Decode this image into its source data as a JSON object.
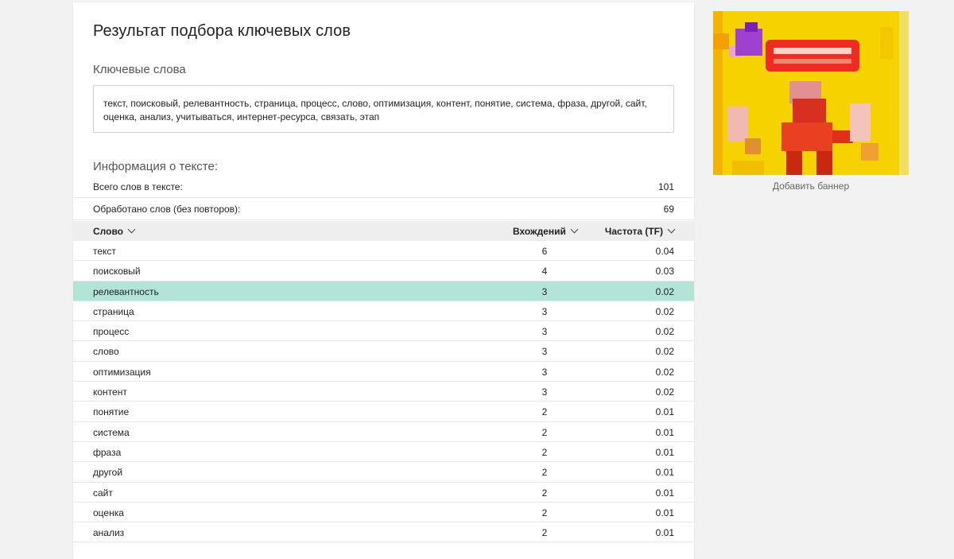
{
  "title": "Результат подбора ключевых слов",
  "keywords": {
    "heading": "Ключевые слова",
    "text": "текст, поисковый, релевантность, страница, процесс, слово, оптимизация, контент, понятие, система, фраза, другой, сайт, оценка, анализ, учитываться, интернет-ресурса, связать, этап"
  },
  "info": {
    "heading": "Информация о тексте:",
    "rows": [
      {
        "label": "Всего слов в тексте:",
        "value": "101"
      },
      {
        "label": "Обработано слов (без повторов):",
        "value": "69"
      }
    ]
  },
  "table": {
    "headers": {
      "word": "Слово",
      "count": "Вхождений",
      "freq": "Частота (TF)"
    },
    "rows": [
      {
        "word": "текст",
        "count": "6",
        "freq": "0.04",
        "highlight": false
      },
      {
        "word": "поисковый",
        "count": "4",
        "freq": "0.03",
        "highlight": false
      },
      {
        "word": "релевантность",
        "count": "3",
        "freq": "0.02",
        "highlight": true
      },
      {
        "word": "страница",
        "count": "3",
        "freq": "0.02",
        "highlight": false
      },
      {
        "word": "процесс",
        "count": "3",
        "freq": "0.02",
        "highlight": false
      },
      {
        "word": "слово",
        "count": "3",
        "freq": "0.02",
        "highlight": false
      },
      {
        "word": "оптимизация",
        "count": "3",
        "freq": "0.02",
        "highlight": false
      },
      {
        "word": "контент",
        "count": "3",
        "freq": "0.02",
        "highlight": false
      },
      {
        "word": "понятие",
        "count": "2",
        "freq": "0.01",
        "highlight": false
      },
      {
        "word": "система",
        "count": "2",
        "freq": "0.01",
        "highlight": false
      },
      {
        "word": "фраза",
        "count": "2",
        "freq": "0.01",
        "highlight": false
      },
      {
        "word": "другой",
        "count": "2",
        "freq": "0.01",
        "highlight": false
      },
      {
        "word": "сайт",
        "count": "2",
        "freq": "0.01",
        "highlight": false
      },
      {
        "word": "оценка",
        "count": "2",
        "freq": "0.01",
        "highlight": false
      },
      {
        "word": "анализ",
        "count": "2",
        "freq": "0.01",
        "highlight": false
      }
    ]
  },
  "sidebar": {
    "banner_caption": "Добавить баннер"
  },
  "colors": {
    "highlight_row": "#b2e4d8",
    "table_header": "#eeeeee",
    "page_background": "#f2f2f2",
    "banner_yellow": "#f5d400"
  },
  "icons": {
    "sort": "chevron-down-icon"
  }
}
